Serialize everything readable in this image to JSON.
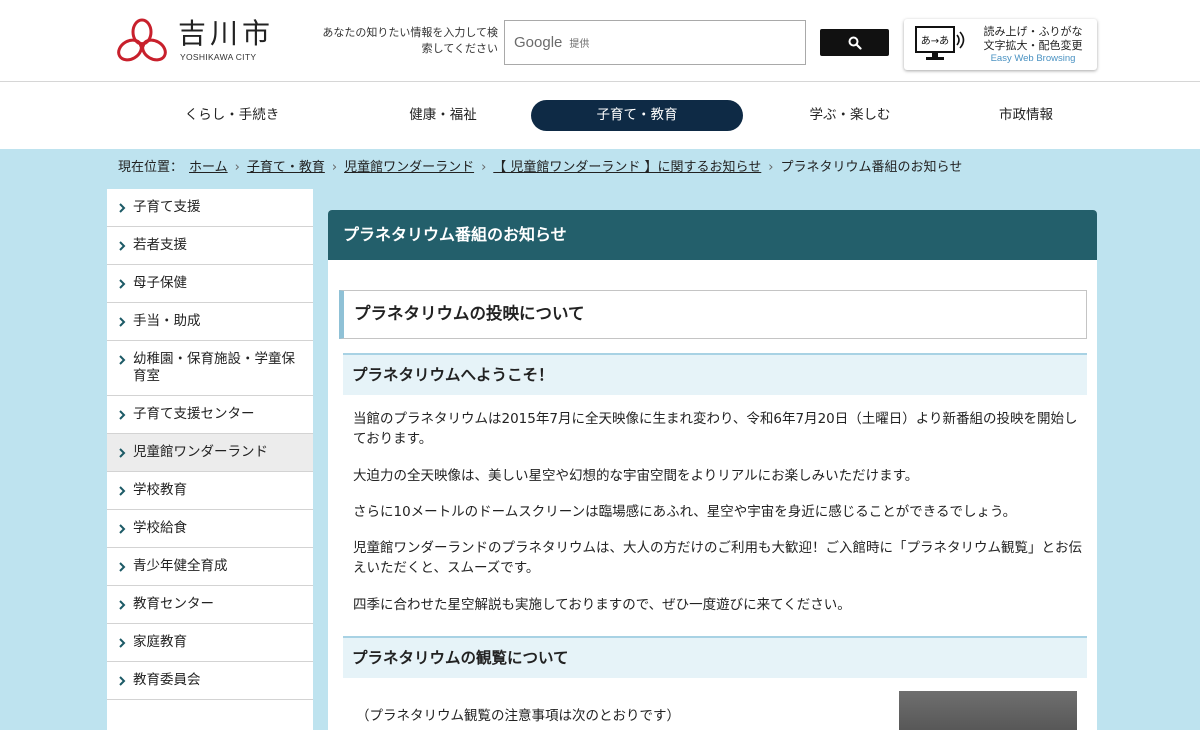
{
  "header": {
    "logo_text": "吉川市",
    "logo_sub": "YOSHIKAWA CITY",
    "search_note": "あなたの知りたい情報を入力して検索してください",
    "search_brand": "Google",
    "search_brand_sub": "提供",
    "ewb": {
      "line1": "読み上げ・ふりがな",
      "line2": "文字拡大・配色変更",
      "line3": "Easy Web Browsing",
      "icon_text": "あ→あ"
    }
  },
  "nav": [
    {
      "label": "くらし・手続き",
      "active": false
    },
    {
      "label": "健康・福祉",
      "active": false
    },
    {
      "label": "子育て・教育",
      "active": true
    },
    {
      "label": "学ぶ・楽しむ",
      "active": false
    },
    {
      "label": "市政情報",
      "active": false
    }
  ],
  "breadcrumb": {
    "label": "現在位置：",
    "items": [
      "ホーム",
      "子育て・教育",
      "児童館ワンダーランド",
      "【 児童館ワンダーランド 】に関するお知らせ"
    ],
    "current": "プラネタリウム番組のお知らせ"
  },
  "sidebar": [
    {
      "label": "子育て支援"
    },
    {
      "label": "若者支援"
    },
    {
      "label": "母子保健"
    },
    {
      "label": "手当・助成"
    },
    {
      "label": "幼稚園・保育施設・学童保育室"
    },
    {
      "label": "子育て支援センター"
    },
    {
      "label": "児童館ワンダーランド",
      "active": true
    },
    {
      "label": "学校教育"
    },
    {
      "label": "学校給食"
    },
    {
      "label": "青少年健全育成"
    },
    {
      "label": "教育センター"
    },
    {
      "label": "家庭教育"
    },
    {
      "label": "教育委員会"
    }
  ],
  "main": {
    "title": "プラネタリウム番組のお知らせ",
    "h2": "プラネタリウムの投映について",
    "h3_welcome": "プラネタリウムへようこそ！",
    "paragraphs": [
      "当館のプラネタリウムは2015年7月に全天映像に生まれ変わり、令和6年7月20日（土曜日）より新番組の投映を開始しております。",
      "大迫力の全天映像は、美しい星空や幻想的な宇宙空間をよりリアルにお楽しみいただけます。",
      "さらに10メートルのドームスクリーンは臨場感にあふれ、星空や宇宙を身近に感じることができるでしょう。",
      "児童館ワンダーランドのプラネタリウムは、大人の方だけのご利用も大歓迎！ご入館時に「プラネタリウム観覧」とお伝えいただくと、スムーズです。",
      "四季に合わせた星空解説も実施しておりますので、ぜひ一度遊びに来てください。"
    ],
    "h3_viewing": "プラネタリウムの観覧について",
    "note": "（プラネタリウム観覧の注意事項は次のとおりです）"
  },
  "colors": {
    "page_bg": "#bee3ef",
    "nav_active": "#0e2a45",
    "title_bar": "#235f6b",
    "logo_red": "#c8202c",
    "ewb_blue": "#4a92c2"
  }
}
